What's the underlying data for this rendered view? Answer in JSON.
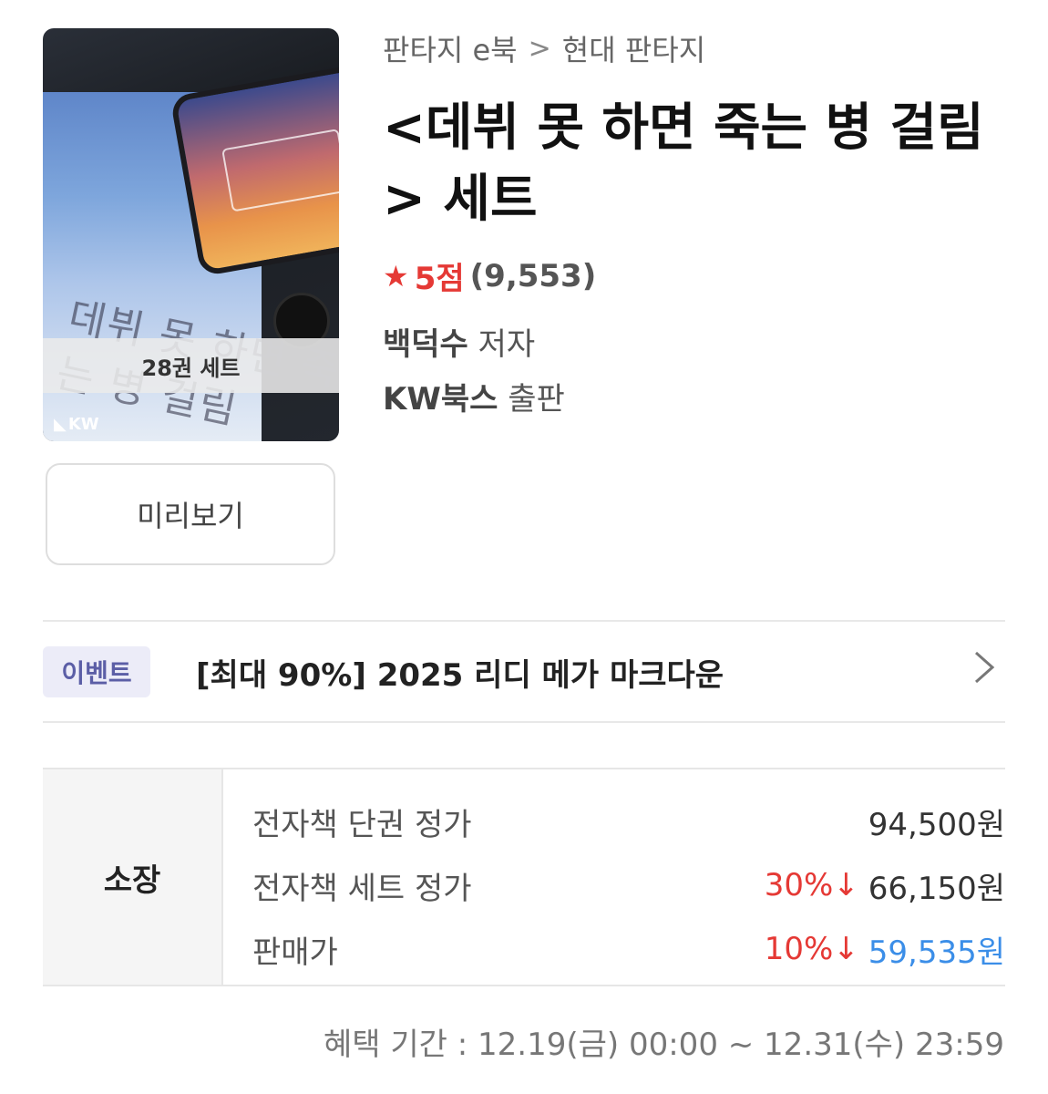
{
  "breadcrumb": {
    "category": "판타지 e북",
    "separator": ">",
    "subcategory": "현대 판타지"
  },
  "book": {
    "title": "<데뷔 못 하면 죽는 병 걸림 > 세트",
    "rating_score": "5점",
    "rating_count": "(9,553)",
    "author_name": "백덕수",
    "author_role": "저자",
    "publisher_name": "KW북스",
    "publisher_role": "출판",
    "cover_badge": "28권 세트",
    "cover_logo": "KW",
    "cover_title_art": "데뷔 못 하면 죽는 병 걸림"
  },
  "preview_label": "미리보기",
  "event": {
    "badge": "이벤트",
    "text": "[최대 90%] 2025 리디 메가 마크다운"
  },
  "price": {
    "section_label": "소장",
    "rows": [
      {
        "label": "전자책 단권 정가",
        "discount": "",
        "value": "94,500원"
      },
      {
        "label": "전자책 세트 정가",
        "discount": "30%↓",
        "value": "66,150원"
      },
      {
        "label": "판매가",
        "discount": "10%↓",
        "value": "59,535원"
      }
    ]
  },
  "benefit_period": "혜택 기간 : 12.19(금) 00:00 ~ 12.31(수) 23:59",
  "colors": {
    "accent_red": "#e53935",
    "final_price_blue": "#3b8ee8",
    "event_badge_bg": "#ececf8",
    "event_badge_text": "#5b5ea6"
  }
}
